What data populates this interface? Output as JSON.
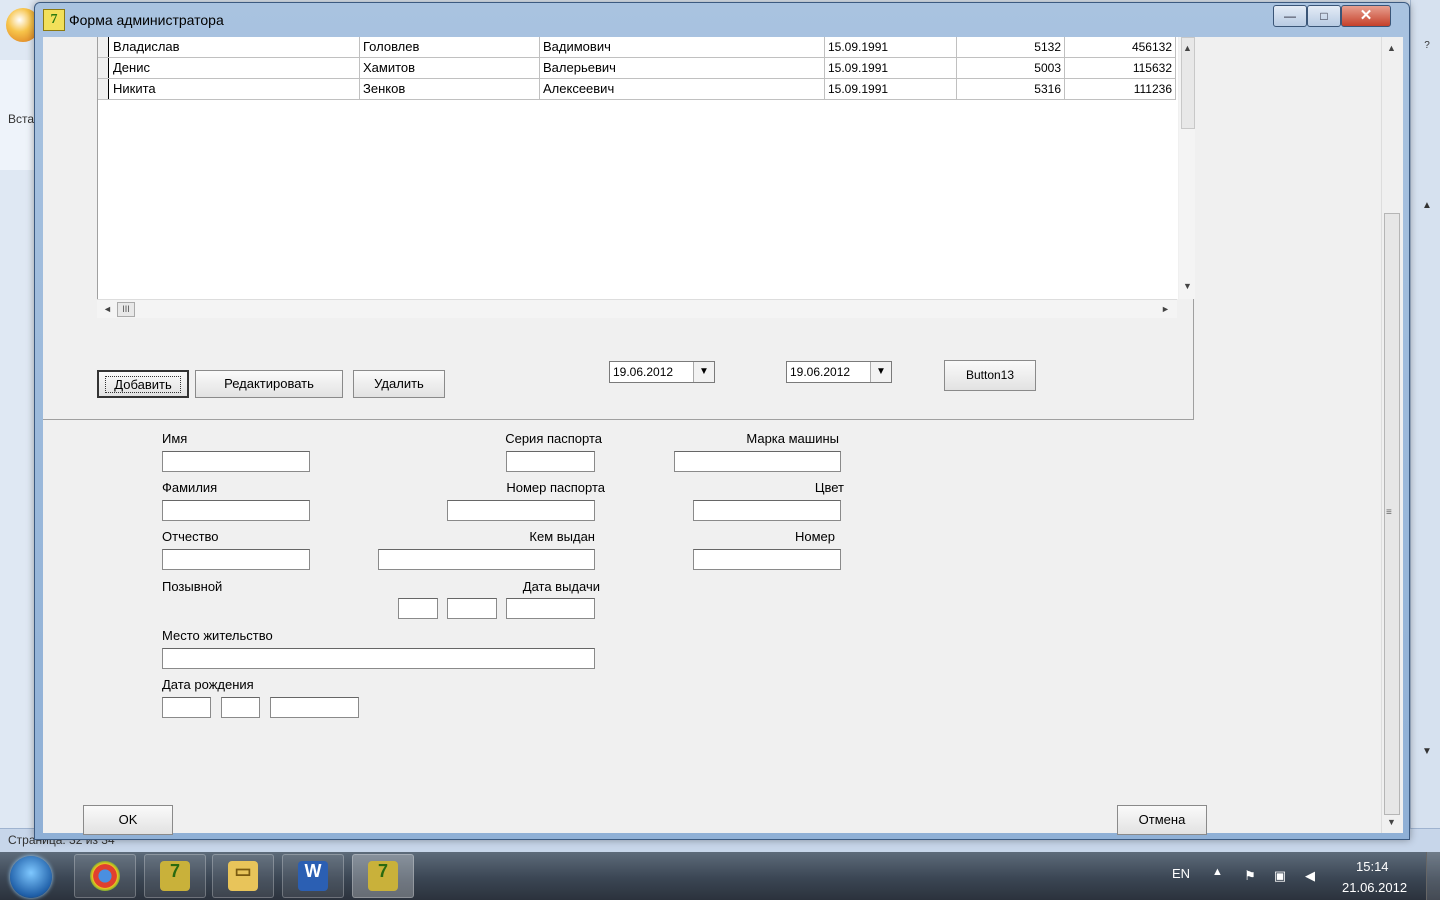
{
  "window": {
    "title": "Форма администратора",
    "close_glyph": "✕",
    "min_glyph": "—",
    "max_glyph": "□"
  },
  "background_app": {
    "ribbon_label": "Вста",
    "status_left": "Страница: 32 из 34"
  },
  "grid": {
    "rows": [
      {
        "first": "Владислав",
        "last": "Головлев",
        "patronymic": "Вадимович",
        "date": "15.09.1991",
        "n1": "5132",
        "n2": "456132"
      },
      {
        "first": "Денис",
        "last": "Хамитов",
        "patronymic": "Валерьевич",
        "date": "15.09.1991",
        "n1": "5003",
        "n2": "115632"
      },
      {
        "first": "Никита",
        "last": "Зенков",
        "patronymic": "Алексеевич",
        "date": "15.09.1991",
        "n1": "5316",
        "n2": "111236"
      }
    ],
    "hscroll_grip": "III"
  },
  "buttons": {
    "add": "Добавить",
    "edit": "Редактировать",
    "delete": "Удалить",
    "button13": "Button13",
    "ok": "OK",
    "cancel": "Отмена"
  },
  "date_pickers": {
    "date1": "19.06.2012",
    "date2": "19.06.2012"
  },
  "form": {
    "name_label": "Имя",
    "surname_label": "Фамилия",
    "patronymic_label": "Отчество",
    "callsign_label": "Позывной",
    "residence_label": "Место жительство",
    "birthdate_label": "Дата рождения",
    "passport_series_label": "Серия паспорта",
    "passport_number_label": "Номер паспорта",
    "issued_by_label": "Кем выдан",
    "issue_date_label": "Дата выдачи",
    "car_brand_label": "Марка машины",
    "color_label": "Цвет",
    "plate_label": "Номер"
  },
  "taskbar": {
    "items": [
      "chrome",
      "delphi",
      "explorer",
      "word",
      "delphi-active"
    ],
    "language": "EN",
    "time": "15:14",
    "date": "21.06.2012"
  },
  "icons": {
    "dropdown": "▼",
    "up": "▲",
    "left": "◄",
    "right": "►",
    "tray_up": "▲"
  }
}
